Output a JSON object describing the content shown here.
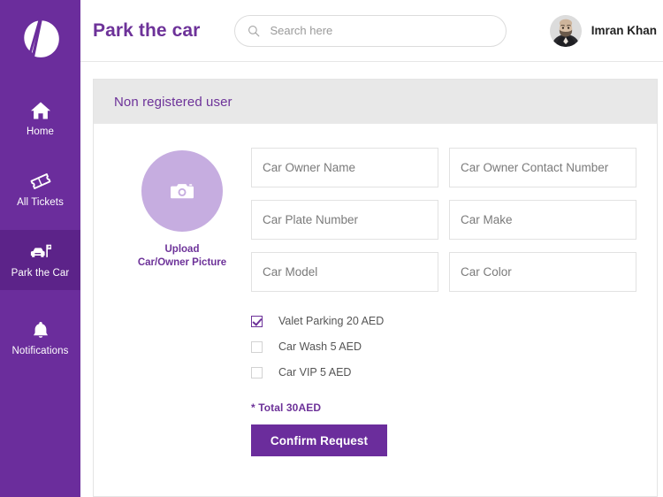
{
  "brand": {
    "sidebar_color": "#6b2d9c",
    "sidebar_active_color": "#5c2389",
    "accent_color": "#6d3299",
    "upload_circle_color": "#c6ade0",
    "panel_header_color": "#e8e8e8",
    "logo_name": "v-logo-icon"
  },
  "sidebar": {
    "items": [
      {
        "label": "Home",
        "icon": "home-icon",
        "active": false
      },
      {
        "label": "All Tickets",
        "icon": "ticket-icon",
        "active": false
      },
      {
        "label": "Park the Car",
        "icon": "car-parking-icon",
        "active": true
      },
      {
        "label": "Notifications",
        "icon": "bell-icon",
        "active": false
      }
    ]
  },
  "header": {
    "title": "Park the car",
    "search": {
      "placeholder": "Search here",
      "value": "",
      "icon": "search-icon"
    },
    "user": {
      "name": "Imran Khan",
      "avatar": "user-avatar"
    }
  },
  "panel": {
    "title": "Non registered user"
  },
  "upload": {
    "icon": "camera-icon",
    "caption_line1": "Upload",
    "caption_line2": "Car/Owner Picture"
  },
  "form": {
    "fields": [
      {
        "name": "car-owner-name",
        "placeholder": "Car Owner Name",
        "value": ""
      },
      {
        "name": "car-owner-contact-number",
        "placeholder": "Car Owner Contact Number",
        "value": ""
      },
      {
        "name": "car-plate-number",
        "placeholder": "Car Plate Number",
        "value": ""
      },
      {
        "name": "car-make",
        "placeholder": "Car Make",
        "value": ""
      },
      {
        "name": "car-model",
        "placeholder": "Car Model",
        "value": ""
      },
      {
        "name": "car-color",
        "placeholder": "Car Color",
        "value": ""
      }
    ]
  },
  "options": [
    {
      "name": "valet-parking",
      "label": "Valet Parking 20 AED",
      "checked": true
    },
    {
      "name": "car-wash",
      "label": "Car Wash 5 AED",
      "checked": false
    },
    {
      "name": "car-vip",
      "label": "Car VIP 5 AED",
      "checked": false
    }
  ],
  "summary": {
    "total_text": "* Total 30AED",
    "confirm_label": "Confirm Request"
  }
}
